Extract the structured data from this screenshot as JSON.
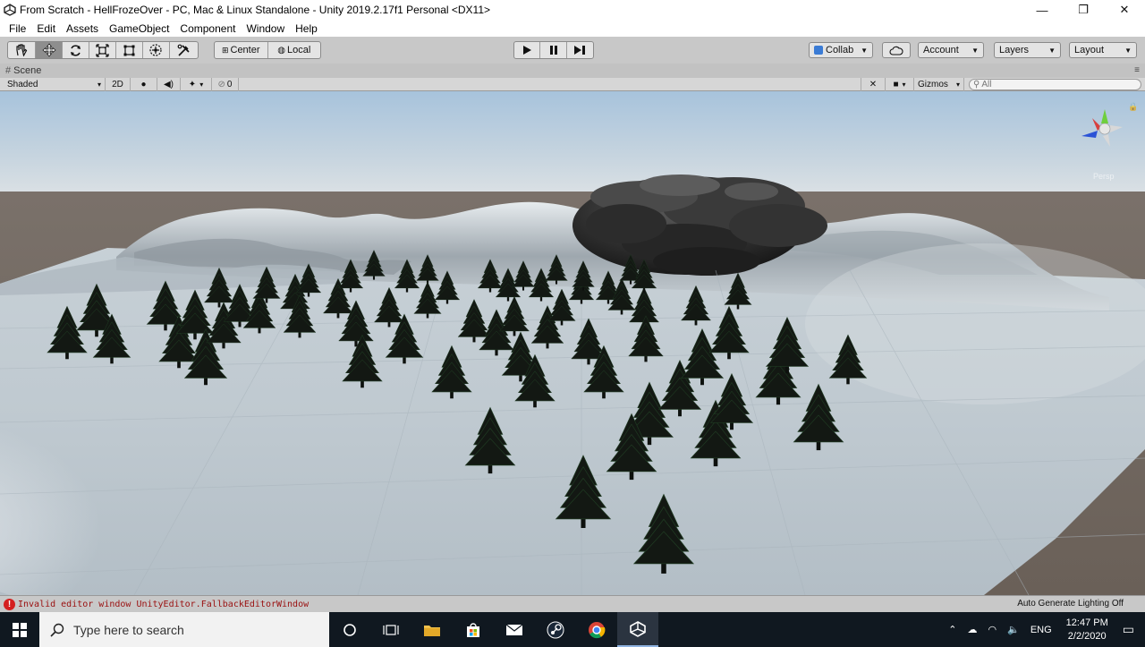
{
  "window": {
    "title": "From Scratch - HellFrozeOver - PC, Mac & Linux Standalone - Unity 2019.2.17f1 Personal <DX11>",
    "minimize": "—",
    "maximize": "❐",
    "close": "✕"
  },
  "menu": {
    "items": [
      "File",
      "Edit",
      "Assets",
      "GameObject",
      "Component",
      "Window",
      "Help"
    ]
  },
  "toolbar": {
    "pivot_label": "Center",
    "space_label": "Local",
    "collab_label": "Collab",
    "account_label": "Account",
    "layers_label": "Layers",
    "layout_label": "Layout"
  },
  "scene": {
    "tab_label": "Scene",
    "shading_mode": "Shaded",
    "mode_2d": "2D",
    "hidden_count": "0",
    "gizmos_label": "Gizmos",
    "search_placeholder": "All",
    "gizmo_persp_label": "Persp"
  },
  "status": {
    "error_message": "Invalid editor window UnityEditor.FallbackEditorWindow",
    "lighting": "Auto Generate Lighting Off"
  },
  "taskbar": {
    "search_placeholder": "Type here to search",
    "language": "ENG",
    "time": "12:47 PM",
    "date": "2/2/2020"
  },
  "colors": {
    "sky_top": "#a9c6e0",
    "horizon": "#d3dadf",
    "ground_brown": "#6f6660",
    "terrain_snow": "#c4cdd4",
    "tree_dark": "#121712",
    "error_red": "#d42020",
    "taskbar": "#101820"
  }
}
